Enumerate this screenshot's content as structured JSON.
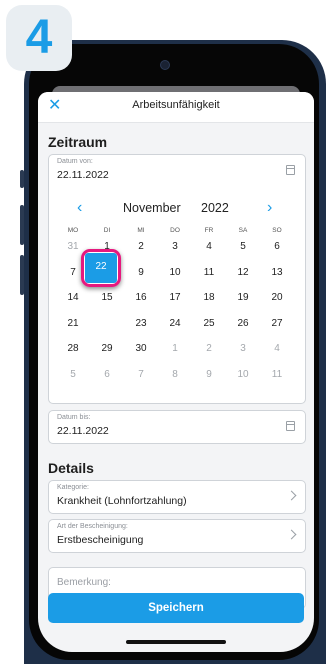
{
  "step": "4",
  "nav": {
    "close": "✕",
    "title": "Arbeitsunfähigkeit"
  },
  "zeitraum": {
    "title": "Zeitraum",
    "from": {
      "label": "Datum von:",
      "value": "22.11.2022"
    },
    "to": {
      "label": "Datum bis:",
      "value": "22.11.2022"
    },
    "calendar": {
      "prev": "‹",
      "next": "›",
      "month": "November",
      "year": "2022",
      "weekdays": [
        "MO",
        "DI",
        "MI",
        "DO",
        "FR",
        "SA",
        "SO"
      ],
      "weeks": [
        [
          "31",
          "1",
          "2",
          "3",
          "4",
          "5",
          "6"
        ],
        [
          "7",
          "8",
          "9",
          "10",
          "11",
          "12",
          "13"
        ],
        [
          "14",
          "15",
          "16",
          "17",
          "18",
          "19",
          "20"
        ],
        [
          "21",
          "22",
          "23",
          "24",
          "25",
          "26",
          "27"
        ],
        [
          "28",
          "29",
          "30",
          "1",
          "2",
          "3",
          "4"
        ],
        [
          "5",
          "6",
          "7",
          "8",
          "9",
          "10",
          "11"
        ]
      ],
      "selected": "22"
    }
  },
  "details": {
    "title": "Details",
    "kategorie": {
      "label": "Kategorie:",
      "value": "Krankheit (Lohnfortzahlung)"
    },
    "bescheinigung": {
      "label": "Art der Bescheinigung:",
      "value": "Erstbescheinigung"
    },
    "bemerkung": {
      "placeholder": "Bemerkung:"
    }
  },
  "save": "Speichern",
  "colors": {
    "accent": "#1b9ce6",
    "highlight": "#e5197e"
  }
}
